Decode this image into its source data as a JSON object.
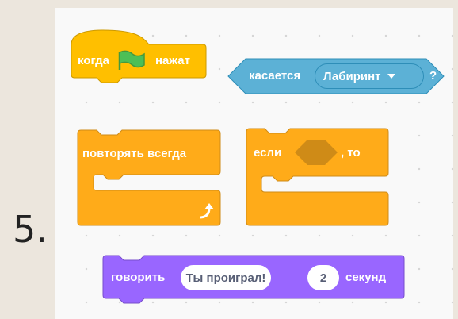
{
  "question_number": "5.",
  "blocks": {
    "when_flag": {
      "before": "когда",
      "after": "нажат",
      "icon": "green-flag-icon",
      "color": "#ffbf00"
    },
    "touching": {
      "label": "касается",
      "dropdown": "Лабиринт",
      "suffix": "?",
      "color": "#5cb1d6"
    },
    "forever": {
      "label": "повторять всегда",
      "icon": "loop-arrow-icon",
      "color": "#ffab19"
    },
    "if_then": {
      "before": "если",
      "after": ", то",
      "color": "#ffab19"
    },
    "say_for": {
      "label": "говорить",
      "message": "Ты проиграл!",
      "seconds": "2",
      "unit": "секунд",
      "color": "#9966ff"
    }
  }
}
